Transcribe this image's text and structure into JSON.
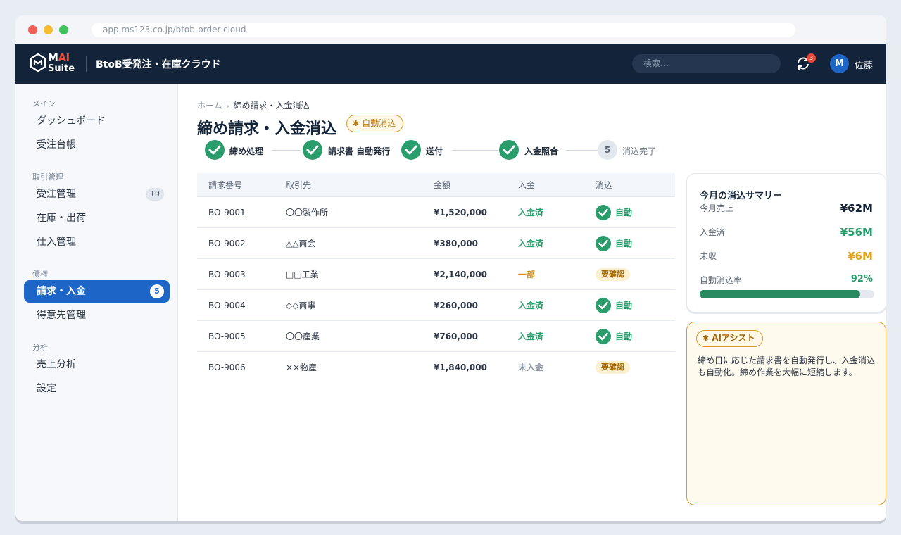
{
  "browser": {
    "url": "app.ms123.co.jp/btob-order-cloud"
  },
  "header": {
    "logo_top": "M",
    "logo_ai": "AI",
    "logo_suite": "Suite",
    "title": "BtoB受発注・在庫クラウド",
    "search_placeholder": "検索…",
    "notification_count": "3",
    "avatar_initial": "M",
    "user_name": "佐藤"
  },
  "sidebar": {
    "groups": {
      "main": "メイン",
      "trade": "取引管理",
      "receivable": "債権",
      "analysis": "分析"
    },
    "items": {
      "dashboard": "ダッシュボード",
      "order_ledger": "受注台帳",
      "order_mgmt": "受注管理",
      "order_mgmt_badge": "19",
      "inventory": "在庫・出荷",
      "purchase": "仕入管理",
      "billing": "請求・入金",
      "billing_badge": "5",
      "customers": "得意先管理",
      "sales_analysis": "売上分析",
      "settings": "設定"
    }
  },
  "breadcrumb": {
    "home": "ホーム",
    "current": "締め請求・入金消込"
  },
  "page": {
    "title": "締め請求・入金消込",
    "badge": "自動消込"
  },
  "steps": [
    {
      "label": "締め処理",
      "status": "done"
    },
    {
      "label": "請求書 自動発行",
      "status": "done"
    },
    {
      "label": "送付",
      "status": "done"
    },
    {
      "label": "入金照合",
      "status": "done"
    },
    {
      "label": "消込完了",
      "status": "pending",
      "number": "5"
    }
  ],
  "table": {
    "headers": {
      "invoice": "請求番号",
      "partner": "取引先",
      "amount": "金額",
      "payment": "入金",
      "recon": "消込"
    },
    "rows": [
      {
        "invoice": "BO-9001",
        "partner": "〇〇製作所",
        "amount": "¥1,520,000",
        "payment": "入金済",
        "recon": "自動"
      },
      {
        "invoice": "BO-9002",
        "partner": "△△商会",
        "amount": "¥380,000",
        "payment": "入金済",
        "recon": "自動"
      },
      {
        "invoice": "BO-9003",
        "partner": "□□工業",
        "amount": "¥2,140,000",
        "payment": "一部",
        "recon": "要確認"
      },
      {
        "invoice": "BO-9004",
        "partner": "◇◇商事",
        "amount": "¥260,000",
        "payment": "入金済",
        "recon": "自動"
      },
      {
        "invoice": "BO-9005",
        "partner": "〇〇産業",
        "amount": "¥760,000",
        "payment": "入金済",
        "recon": "自動"
      },
      {
        "invoice": "BO-9006",
        "partner": "××物産",
        "amount": "¥1,840,000",
        "payment": "未入金",
        "recon": "要確認"
      }
    ]
  },
  "summary": {
    "title": "今月の消込サマリー",
    "sales_label": "今月売上",
    "sales_value": "¥62M",
    "received_label": "入金済",
    "received_value": "¥56M",
    "outstanding_label": "未収",
    "outstanding_value": "¥6M",
    "rate_label": "自動消込率",
    "rate_value": "92%",
    "rate_fraction": 0.92
  },
  "ai": {
    "badge": "AIアシスト",
    "text": "締め日に応じた請求書を自動発行し、入金消込も自動化。締め作業を大幅に短縮します。"
  },
  "colors": {
    "navbar": "#13243a",
    "accent": "#1d66c7",
    "success": "#2a9d6c",
    "warning": "#d89a2a",
    "danger": "#e74c3c"
  }
}
